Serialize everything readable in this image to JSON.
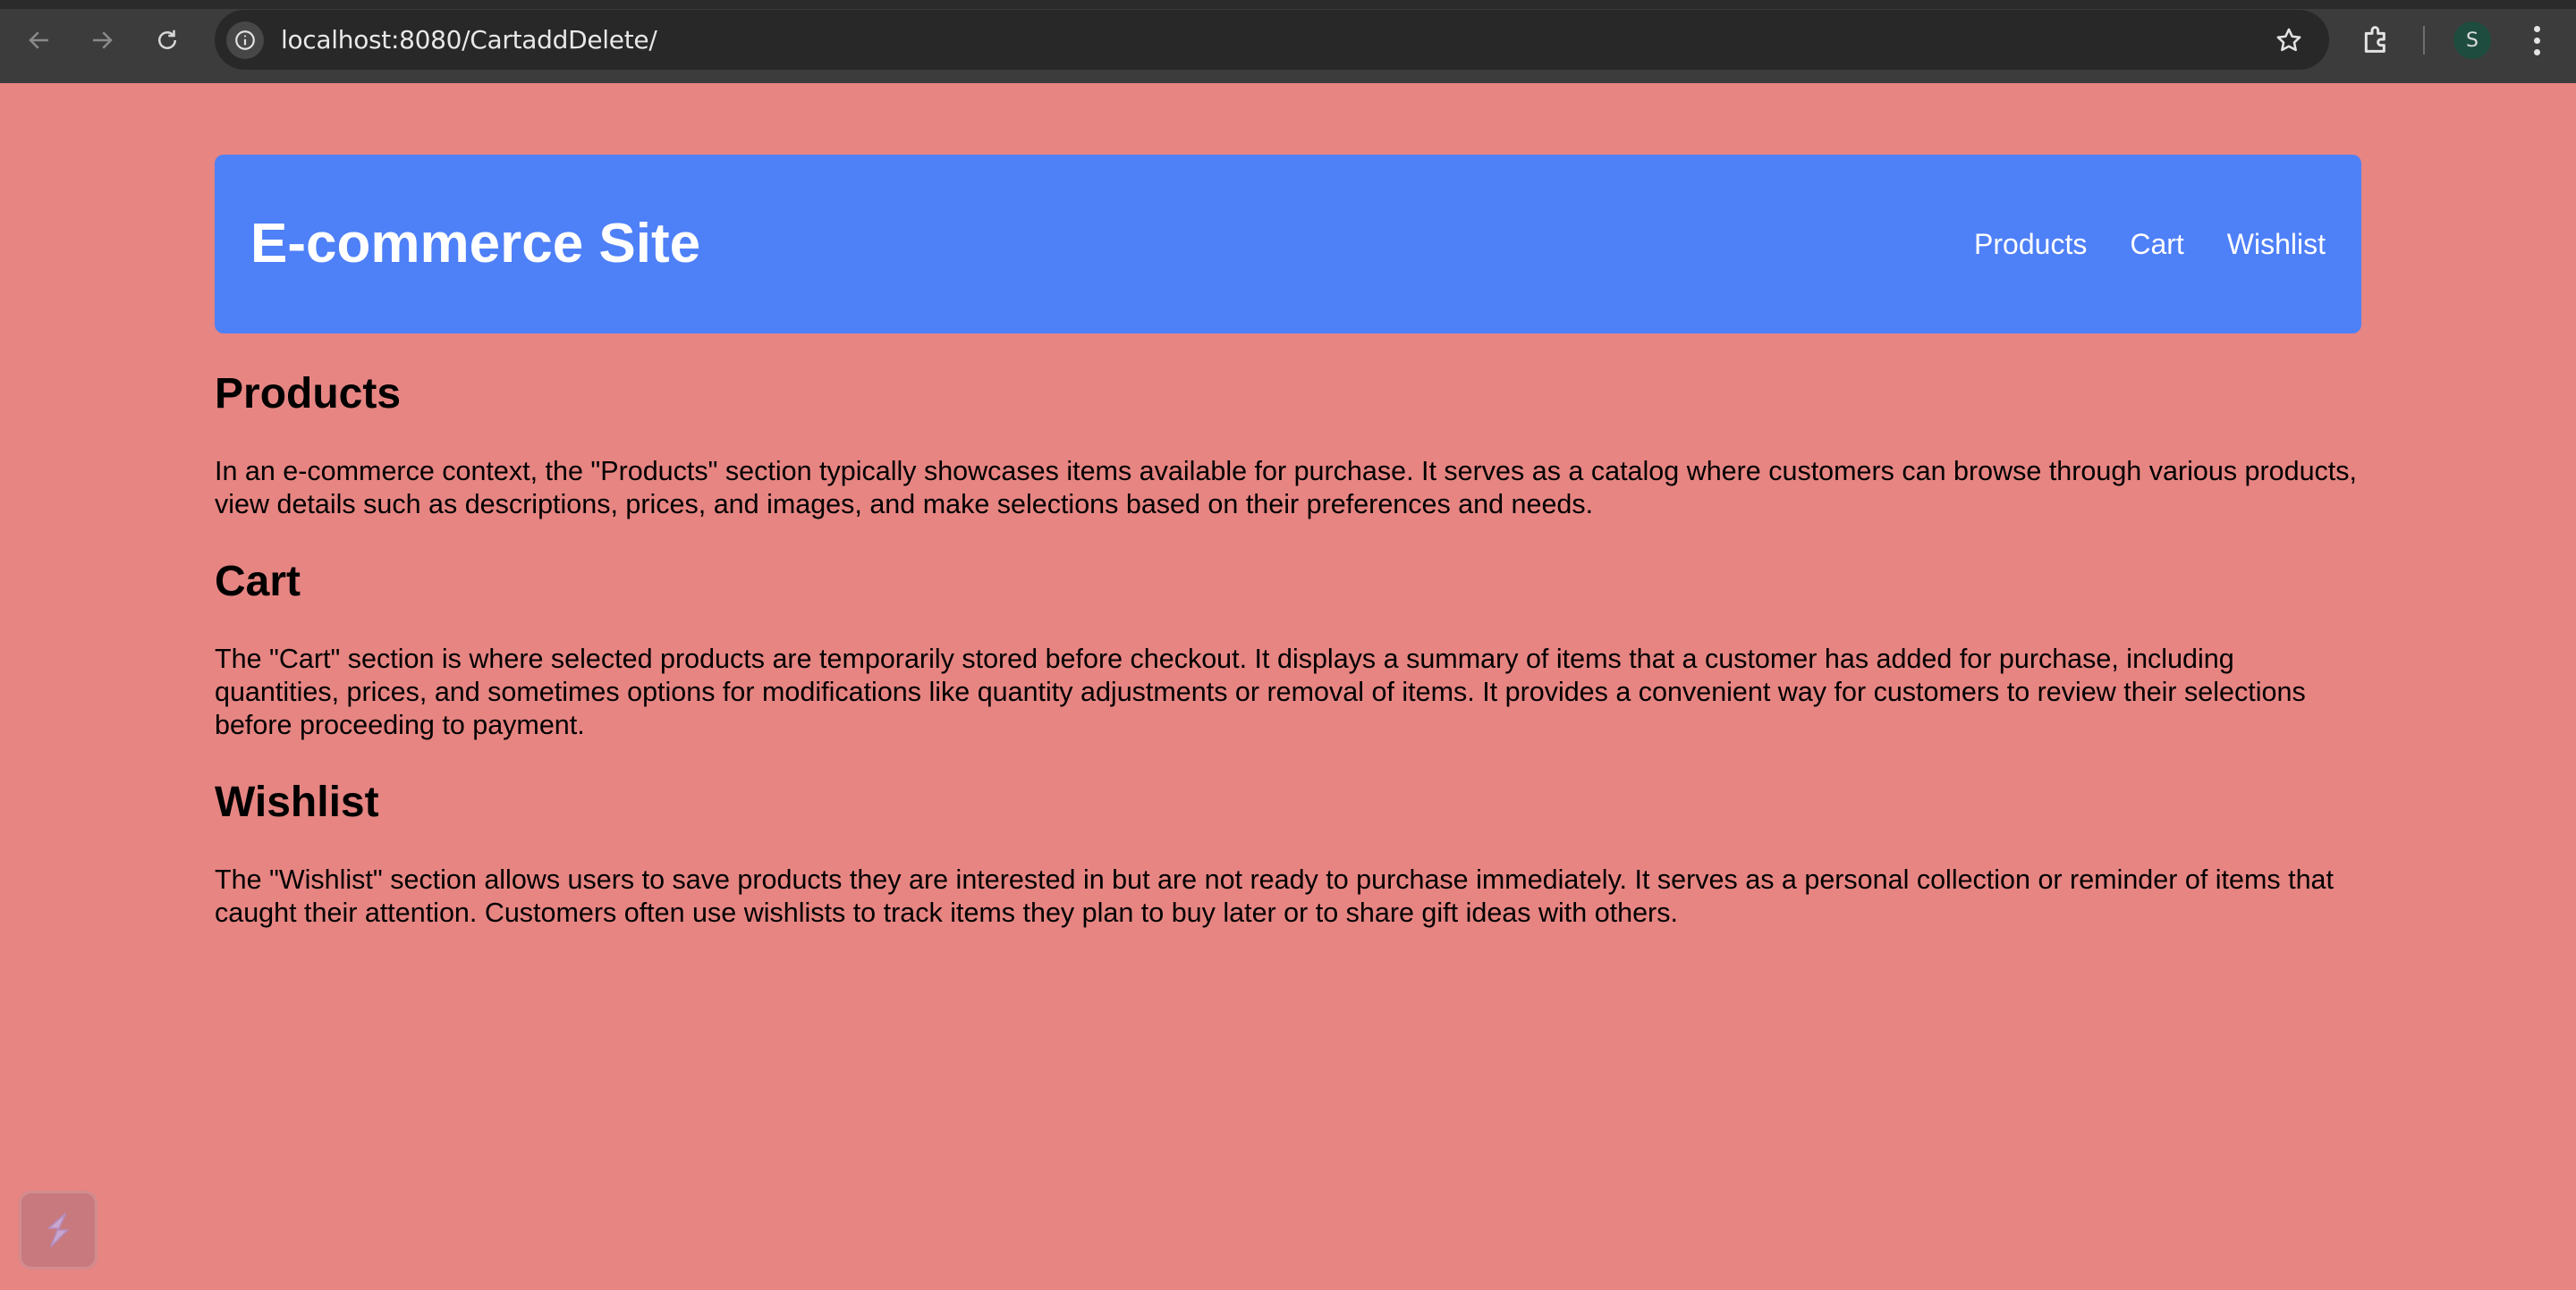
{
  "browser": {
    "url": "localhost:8080/CartaddDelete/",
    "profile_initial": "S"
  },
  "site": {
    "title": "E-commerce Site",
    "nav": [
      "Products",
      "Cart",
      "Wishlist"
    ],
    "colors": {
      "page_background": "#e68582",
      "header_background": "#4e80f7"
    }
  },
  "sections": [
    {
      "heading": "Products",
      "body": "In an e-commerce context, the \"Products\" section typically showcases items available for purchase. It serves as a catalog where customers can browse through various products, view details such as descriptions, prices, and images, and make selections based on their preferences and needs."
    },
    {
      "heading": "Cart",
      "body": "The \"Cart\" section is where selected products are temporarily stored before checkout. It displays a summary of items that a customer has added for purchase, including quantities, prices, and sometimes options for modifications like quantity adjustments or removal of items. It provides a convenient way for customers to review their selections before proceeding to payment."
    },
    {
      "heading": "Wishlist",
      "body": "The \"Wishlist\" section allows users to save products they are interested in but are not ready to purchase immediately. It serves as a personal collection or reminder of items that caught their attention. Customers often use wishlists to track items they plan to buy later or to share gift ideas with others."
    }
  ]
}
